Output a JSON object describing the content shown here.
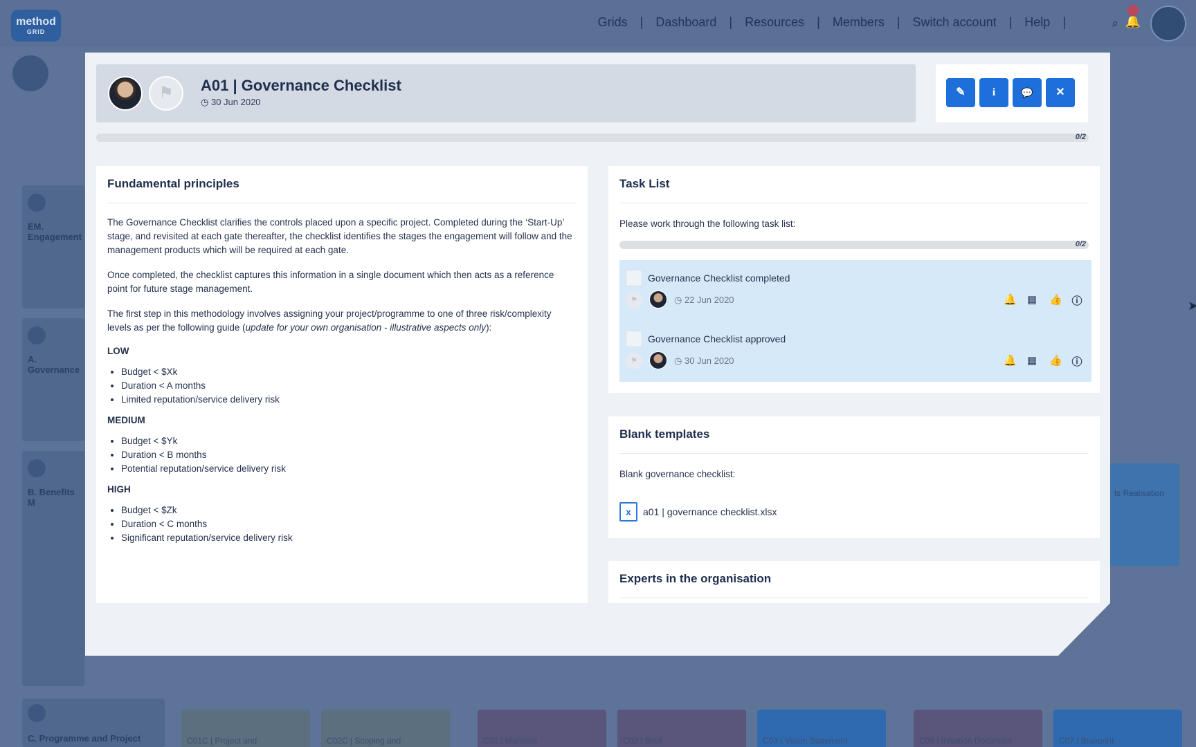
{
  "nav": {
    "logo_line1": "method",
    "logo_line2": "GRID",
    "links": [
      "Grids",
      "Dashboard",
      "Resources",
      "Members",
      "Switch account",
      "Help"
    ],
    "separator": "|",
    "search_icon": "search-icon",
    "bell_icon": "bell-icon",
    "avatar_icon": "user-avatar"
  },
  "background": {
    "row_labels": [
      "EM. Engagement",
      "A. Governance",
      "B. Benefits M",
      "C. Programme and Project"
    ],
    "tiles": [
      "C01C | Project and",
      "C02C | Scoping and",
      "C01 | Mandate",
      "C02 | Brief",
      "C03 | Vision Statement",
      "C06 | Initiation Document",
      "C07 | Blueprint"
    ],
    "right_tile": "ts Realisation"
  },
  "modal": {
    "title": "A01 | Governance Checklist",
    "date": "30 Jun 2020",
    "progress": "0/2",
    "progress_fraction": 0,
    "buttons": {
      "edit": "✎",
      "info": "i",
      "comment": "💬",
      "close": "✕"
    },
    "principles": {
      "title": "Fundamental principles",
      "p1": "The Governance Checklist clarifies the controls placed upon a specific project. Completed during the ‘Start-Up’ stage, and revisited at each gate thereafter, the checklist identifies the stages the engagement will follow and the management products which will be required at each gate.",
      "p2": "Once completed, the checklist captures this information in a single document which then acts as a reference point for future stage management.",
      "p3_start": "The first step in this methodology involves assigning your project/programme to one of three risk/complexity levels as per the following guide (",
      "p3_italic": "update for your own organisation - illustrative aspects only",
      "p3_end": "):",
      "levels": [
        {
          "name": "LOW",
          "items": [
            "Budget < $Xk",
            "Duration < A months",
            "Limited reputation/service delivery risk"
          ]
        },
        {
          "name": "MEDIUM",
          "items": [
            "Budget < $Yk",
            "Duration < B months",
            "Potential reputation/service delivery risk"
          ]
        },
        {
          "name": "HIGH",
          "items": [
            "Budget < $Zk",
            "Duration < C months",
            "Significant reputation/service delivery risk"
          ]
        }
      ]
    },
    "tasklist": {
      "title": "Task List",
      "intro": "Please work through the following task list:",
      "progress": "0/2",
      "tasks": [
        {
          "label": "Governance Checklist completed",
          "date": "22 Jun 2020"
        },
        {
          "label": "Governance Checklist approved",
          "date": "30 Jun 2020"
        }
      ]
    },
    "templates": {
      "title": "Blank templates",
      "intro": "Blank governance checklist:",
      "file": "a01 | governance checklist.xlsx"
    },
    "experts": {
      "title": "Experts in the organisation"
    }
  }
}
